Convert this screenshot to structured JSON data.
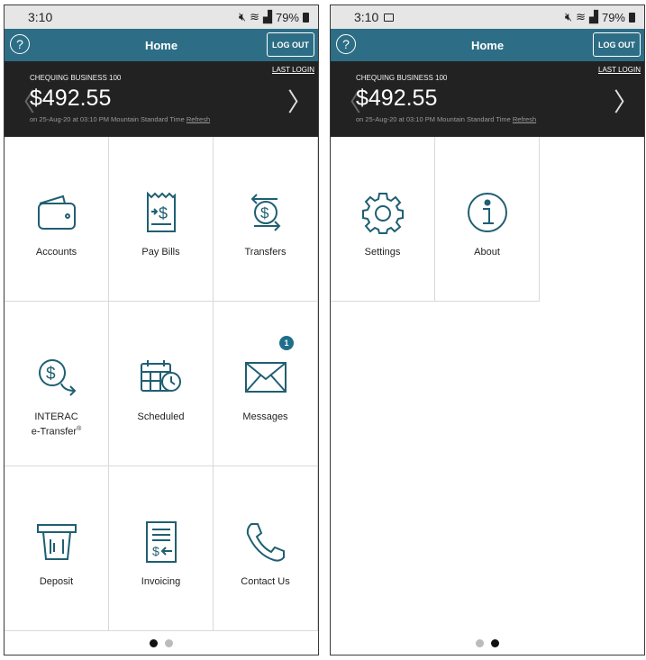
{
  "status": {
    "time": "3:10",
    "battery": "79%",
    "icons": [
      "mute-icon",
      "wifi-icon",
      "signal-icon",
      "battery-icon"
    ]
  },
  "header": {
    "title": "Home",
    "logout_label": "LOG OUT",
    "help_glyph": "?"
  },
  "account": {
    "name": "CHEQUING BUSINESS 100",
    "balance": "$492.55",
    "as_of": "on 25-Aug-20 at 03:10 PM Mountain Standard Time",
    "refresh_label": "Refresh",
    "last_login_label": "LAST LOGIN"
  },
  "page1": {
    "tiles": [
      {
        "label": "Accounts",
        "icon": "wallet-icon"
      },
      {
        "label": "Pay Bills",
        "icon": "bill-icon"
      },
      {
        "label": "Transfers",
        "icon": "transfer-icon"
      },
      {
        "label_line1": "INTERAC",
        "label_line2": "e-Transfer",
        "reg": "®",
        "icon": "etransfer-icon"
      },
      {
        "label": "Scheduled",
        "icon": "calendar-clock-icon"
      },
      {
        "label": "Messages",
        "icon": "envelope-icon",
        "badge": "1"
      },
      {
        "label": "Deposit",
        "icon": "atm-deposit-icon"
      },
      {
        "label": "Invoicing",
        "icon": "invoice-icon"
      },
      {
        "label": "Contact Us",
        "icon": "phone-icon"
      }
    ],
    "page_index": 1,
    "page_count": 2
  },
  "page2": {
    "tiles": [
      {
        "label": "Settings",
        "icon": "gear-icon"
      },
      {
        "label": "About",
        "icon": "info-icon"
      }
    ],
    "page_index": 2,
    "page_count": 2
  },
  "colors": {
    "brand": "#2d6e86",
    "icon": "#1f5f72",
    "balance_bg": "#222222",
    "badge": "#1f6f8b"
  }
}
